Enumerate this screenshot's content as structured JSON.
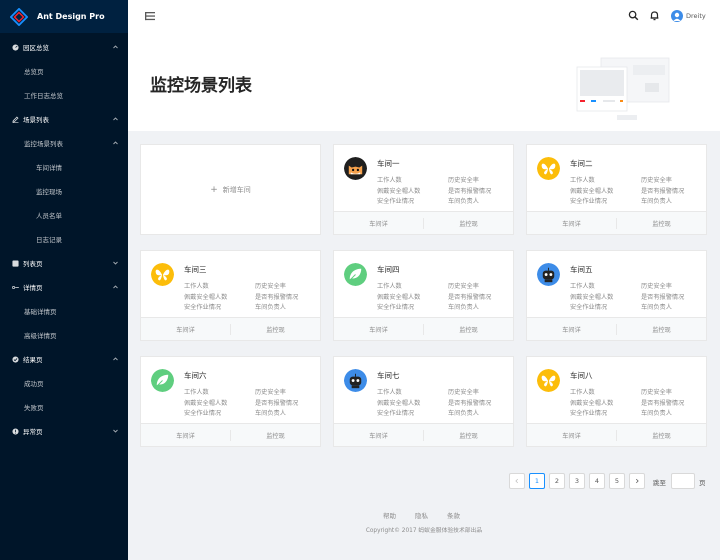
{
  "app": {
    "logo_text": "Ant Design Pro"
  },
  "menu": [
    {
      "label": "园区总览",
      "icon": "dashboard-icon",
      "level": 1,
      "arrow": "up"
    },
    {
      "label": "总览页",
      "level": 2
    },
    {
      "label": "工作日志总览",
      "level": 2
    },
    {
      "label": "场景列表",
      "icon": "edit-icon",
      "level": 1,
      "arrow": "up"
    },
    {
      "label": "监控场景列表",
      "level": 2,
      "arrow": "up"
    },
    {
      "label": "车间详情",
      "level": 3
    },
    {
      "label": "监控现场",
      "level": 3
    },
    {
      "label": "人员名单",
      "level": 3
    },
    {
      "label": "日志记录",
      "level": 3
    },
    {
      "label": "列表页",
      "icon": "table-icon",
      "level": 1,
      "arrow": "down"
    },
    {
      "label": "详情页",
      "icon": "profile-icon",
      "level": 1,
      "arrow": "up"
    },
    {
      "label": "基础详情页",
      "level": 2
    },
    {
      "label": "高级详情页",
      "level": 2
    },
    {
      "label": "结果页",
      "icon": "check-circle-icon",
      "level": 1,
      "arrow": "up"
    },
    {
      "label": "成功页",
      "level": 2
    },
    {
      "label": "失败页",
      "level": 2
    },
    {
      "label": "异常页",
      "icon": "warning-icon",
      "level": 1,
      "arrow": "down"
    }
  ],
  "header": {
    "user_name": "Dreity"
  },
  "page": {
    "title": "监控场景列表",
    "new_card_label": "新增车间"
  },
  "cards": [
    {
      "title": "车间一",
      "avatar": "cat",
      "stats_left": [
        "工作人数",
        "佩戴安全帽人数",
        "安全作业情况"
      ],
      "stats_right": [
        "历史安全率",
        "是否有报警情况",
        "车间负责人"
      ],
      "actions": [
        "车间详",
        "监控现"
      ]
    },
    {
      "title": "车间二",
      "avatar": "butterfly",
      "stats_left": [
        "工作人数",
        "佩戴安全帽人数",
        "安全作业情况"
      ],
      "stats_right": [
        "历史安全率",
        "是否有报警情况",
        "车间负责人"
      ],
      "actions": [
        "车间详",
        "监控现"
      ]
    },
    {
      "title": "车间三",
      "avatar": "butterfly",
      "stats_left": [
        "工作人数",
        "佩戴安全帽人数",
        "安全作业情况"
      ],
      "stats_right": [
        "历史安全率",
        "是否有报警情况",
        "车间负责人"
      ],
      "actions": [
        "车间详",
        "监控现"
      ]
    },
    {
      "title": "车间四",
      "avatar": "leaf",
      "stats_left": [
        "工作人数",
        "佩戴安全帽人数",
        "安全作业情况"
      ],
      "stats_right": [
        "历史安全率",
        "是否有报警情况",
        "车间负责人"
      ],
      "actions": [
        "车间详",
        "监控现"
      ]
    },
    {
      "title": "车间五",
      "avatar": "bot",
      "stats_left": [
        "工作人数",
        "佩戴安全帽人数",
        "安全作业情况"
      ],
      "stats_right": [
        "历史安全率",
        "是否有报警情况",
        "车间负责人"
      ],
      "actions": [
        "车间详",
        "监控现"
      ]
    },
    {
      "title": "车间六",
      "avatar": "leaf",
      "stats_left": [
        "工作人数",
        "佩戴安全帽人数",
        "安全作业情况"
      ],
      "stats_right": [
        "历史安全率",
        "是否有报警情况",
        "车间负责人"
      ],
      "actions": [
        "车间详",
        "监控现"
      ]
    },
    {
      "title": "车间七",
      "avatar": "bot",
      "stats_left": [
        "工作人数",
        "佩戴安全帽人数",
        "安全作业情况"
      ],
      "stats_right": [
        "历史安全率",
        "是否有报警情况",
        "车间负责人"
      ],
      "actions": [
        "车间详",
        "监控现"
      ]
    },
    {
      "title": "车间八",
      "avatar": "butterfly",
      "stats_left": [
        "工作人数",
        "佩戴安全帽人数",
        "安全作业情况"
      ],
      "stats_right": [
        "历史安全率",
        "是否有报警情况",
        "车间负责人"
      ],
      "actions": [
        "车间详",
        "监控现"
      ]
    }
  ],
  "pagination": {
    "pages": [
      "1",
      "2",
      "3",
      "4",
      "5"
    ],
    "current": "1",
    "goto_label": "跳至",
    "goto_suffix": "页"
  },
  "footer": {
    "links": [
      "帮助",
      "隐私",
      "条款"
    ],
    "copyright": "Copyright© 2017 蚂蚁金服体验技术部出品"
  },
  "colors": {
    "sidebar": "#001529",
    "primary": "#1890ff",
    "butterfly": "#fcbd0a",
    "leaf": "#5fce7f",
    "bot": "#3d8ce8",
    "cat": "#1f1f1f"
  }
}
